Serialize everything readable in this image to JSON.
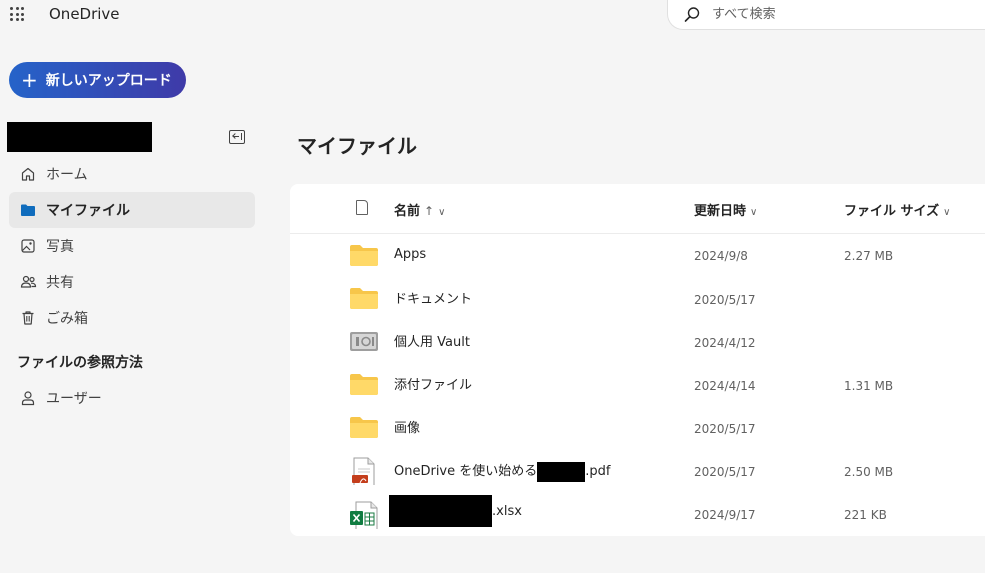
{
  "app": {
    "title": "OneDrive"
  },
  "search": {
    "placeholder": "すべて検索"
  },
  "new_button": {
    "label": "新しいアップロード"
  },
  "sidebar": {
    "items": [
      {
        "label": "ホーム",
        "icon": "home-icon"
      },
      {
        "label": "マイファイル",
        "icon": "folder-icon",
        "active": true
      },
      {
        "label": "写真",
        "icon": "photo-icon"
      },
      {
        "label": "共有",
        "icon": "people-icon"
      },
      {
        "label": "ごみ箱",
        "icon": "trash-icon"
      }
    ],
    "section_title": "ファイルの参照方法",
    "section_items": [
      {
        "label": "ユーザー",
        "icon": "person-icon"
      }
    ]
  },
  "page": {
    "title": "マイファイル"
  },
  "table": {
    "columns": {
      "name": "名前",
      "sort_arrow": "↑",
      "modified": "更新日時",
      "size": "ファイル サイズ"
    },
    "rows": [
      {
        "name": "Apps",
        "date": "2024/9/8",
        "size": "2.27 MB",
        "type": "folder"
      },
      {
        "name": "ドキュメント",
        "date": "2020/5/17",
        "size": "",
        "type": "folder"
      },
      {
        "name": "個人用 Vault",
        "date": "2024/4/12",
        "size": "",
        "type": "vault"
      },
      {
        "name": "添付ファイル",
        "date": "2024/4/14",
        "size": "1.31 MB",
        "type": "folder"
      },
      {
        "name": "画像",
        "date": "2020/5/17",
        "size": "",
        "type": "folder"
      },
      {
        "name_prefix": "OneDrive を使い始める",
        "name_suffix": ".pdf",
        "date": "2020/5/17",
        "size": "2.50 MB",
        "type": "pdf"
      },
      {
        "name_suffix": ".xlsx",
        "date": "2024/9/17",
        "size": "221 KB",
        "type": "excel"
      }
    ]
  },
  "colors": {
    "accent": "#0f6cbd",
    "folder": "#ffd35c",
    "new_button_start": "#2563c9",
    "new_button_end": "#3f3aa8"
  }
}
